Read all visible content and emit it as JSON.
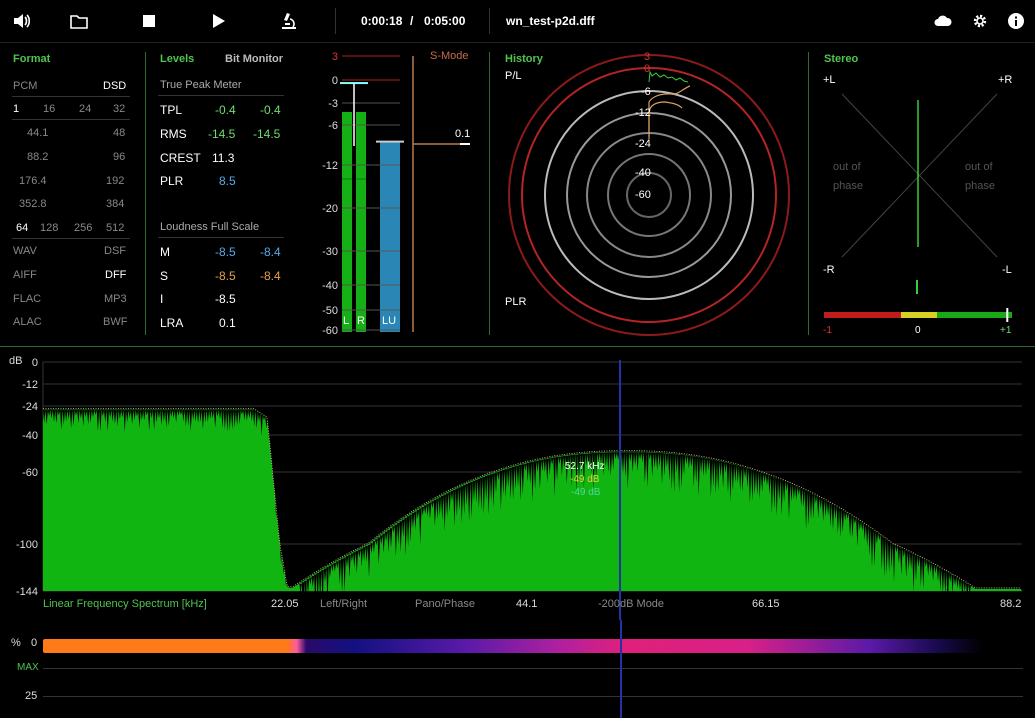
{
  "toolbar": {
    "time_current": "0:00:18",
    "time_sep": "/",
    "time_total": "0:05:00",
    "file_name": "wn_test-p2d.dff"
  },
  "format": {
    "title": "Format",
    "row1": [
      "PCM",
      "DSD"
    ],
    "rates_pcm": [
      "44.1",
      "88.2",
      "176.4",
      "352.8"
    ],
    "rates_dsd": [
      "48",
      "96",
      "192",
      "384"
    ],
    "bits": [
      "1",
      "16",
      "24",
      "32"
    ],
    "dsd_mult": [
      "64",
      "128",
      "256",
      "512"
    ],
    "containers_l": [
      "WAV",
      "AIFF",
      "FLAC",
      "ALAC"
    ],
    "containers_r": [
      "DSF",
      "DFF",
      "MP3",
      "BWF"
    ]
  },
  "levels": {
    "title": "Levels",
    "bit_monitor": "Bit Monitor",
    "tp_title": "True Peak Meter",
    "tpl": {
      "label": "TPL",
      "l": "-0.4",
      "r": "-0.4"
    },
    "rms": {
      "label": "RMS",
      "l": "-14.5",
      "r": "-14.5"
    },
    "crest": {
      "label": "CREST",
      "v": "11.3"
    },
    "plr": {
      "label": "PLR",
      "v": "8.5"
    },
    "lfs_title": "Loudness Full Scale",
    "m": {
      "label": "M",
      "a": "-8.5",
      "b": "-8.4"
    },
    "s": {
      "label": "S",
      "a": "-8.5",
      "b": "-8.4"
    },
    "i": {
      "label": "I",
      "v": "-8.5"
    },
    "lra": {
      "label": "LRA",
      "v": "0.1"
    }
  },
  "meter": {
    "scale": [
      "3",
      "0",
      "-3",
      "-6",
      "-12",
      "-20",
      "-30",
      "-40",
      "-50",
      "-60"
    ],
    "smode": "S-Mode",
    "smode_value": "0.1",
    "labels": [
      "L",
      "R",
      "LU"
    ],
    "levels_db": {
      "L": -14.5,
      "R": -14.5,
      "LU": -8.5
    },
    "peak_db": {
      "L": -0.4,
      "R": -0.4
    }
  },
  "history": {
    "title": "History",
    "pl": "P/L",
    "plr": "PLR",
    "ring_labels": [
      "3",
      "0",
      "-6",
      "-12",
      "-24",
      "-40",
      "-60"
    ]
  },
  "stereo": {
    "title": "Stereo",
    "pl": "+L",
    "pr": "+R",
    "ml": "-R",
    "mr": "-L",
    "oop": "out of phase",
    "corr": [
      "-1",
      "0",
      "+1"
    ],
    "correlation": 0.95
  },
  "spectrum": {
    "db_label": "dB",
    "y_ticks": [
      "0",
      "-12",
      "-24",
      "-40",
      "-60",
      "-100",
      "-144"
    ],
    "x_title": "Linear Frequency Spectrum [kHz]",
    "x_ticks": [
      "22.05",
      "44.1",
      "66.15",
      "88.2"
    ],
    "modes": [
      "Left/Right",
      "Pano/Phase",
      "-200dB Mode"
    ],
    "cursor_freq": "52.7 kHz",
    "cursor_db1": "-49 dB",
    "cursor_db2": "-49 dB"
  },
  "bottom": {
    "pct": "%",
    "zero": "0",
    "max": "MAX",
    "twentyfive": "25"
  },
  "colors": {
    "accent": "#4fc44f",
    "spectrum": "#11b511",
    "meter_lu": "#2a86b4"
  }
}
